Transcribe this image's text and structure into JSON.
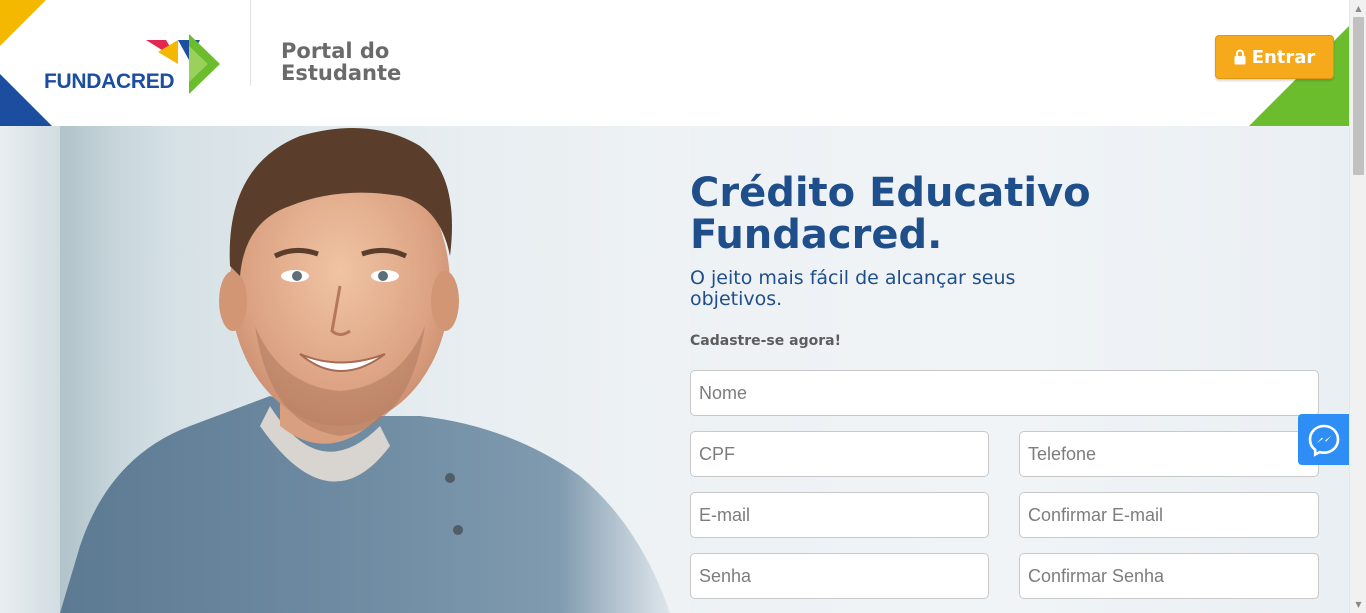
{
  "header": {
    "logo_text": "FUNDACRED",
    "portal_title": "Portal do Estudante",
    "login_button_label": "Entrar",
    "colors": {
      "yellow": "#f5b800",
      "blue": "#1c4ea0",
      "green": "#6cbd2e",
      "red": "#e2284f",
      "button": "#f6a91b"
    }
  },
  "hero": {
    "headline": "Crédito Educativo Fundacred.",
    "subline": "O jeito mais fácil de alcançar seus objetivos.",
    "cta": "Cadastre-se agora!",
    "form": {
      "nome_placeholder": "Nome",
      "cpf_placeholder": "CPF",
      "telefone_placeholder": "Telefone",
      "email_placeholder": "E-mail",
      "confirmar_email_placeholder": "Confirmar E-mail",
      "senha_placeholder": "Senha",
      "confirmar_senha_placeholder": "Confirmar Senha"
    },
    "colors": {
      "headline": "#1f4f8a",
      "messenger": "#2f8ef5"
    }
  },
  "icons": {
    "lock": "lock-icon",
    "messenger": "messenger-icon"
  }
}
